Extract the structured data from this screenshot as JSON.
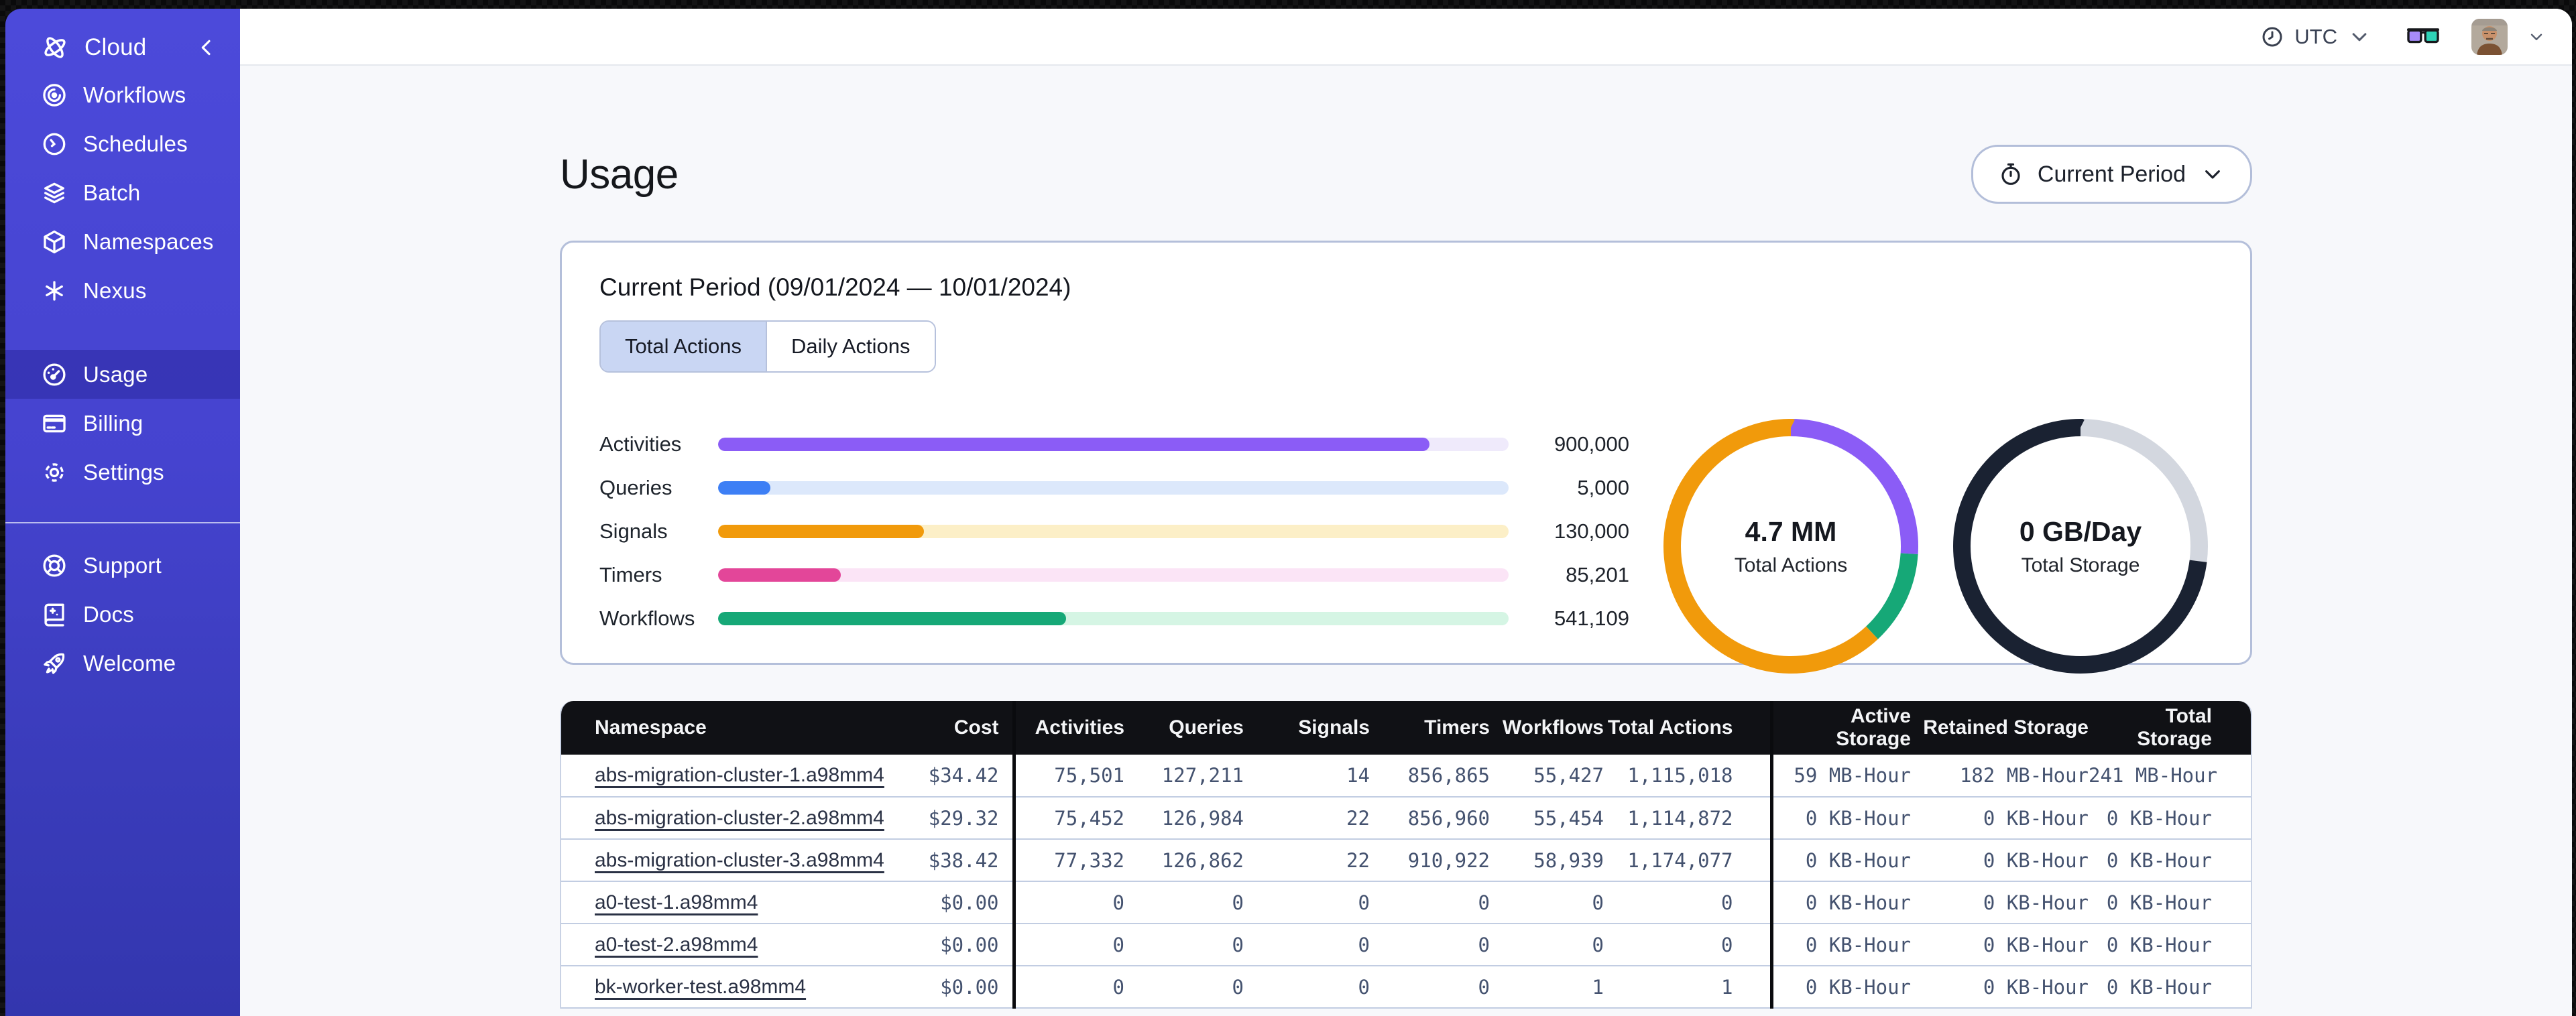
{
  "colors": {
    "sidebar_top": "#4c4ada",
    "sidebar_bottom": "#3336ae",
    "accent_purple": "#8b5cf6",
    "accent_blue": "#3d7ff5",
    "accent_orange": "#f19a0b",
    "accent_pink": "#e34699",
    "accent_green": "#16a877",
    "storage_dark": "#1a2232",
    "storage_gray": "#d3d7df",
    "table_header_bg": "#101115"
  },
  "sidebar": {
    "brand": {
      "label": "Cloud",
      "icon": "temporal-logo",
      "collapse_icon": "chevron-left"
    },
    "sections": [
      {
        "items": [
          {
            "id": "workflows",
            "label": "Workflows",
            "icon": "workflows",
            "active": false
          },
          {
            "id": "schedules",
            "label": "Schedules",
            "icon": "schedules",
            "active": false
          },
          {
            "id": "batch",
            "label": "Batch",
            "icon": "batch",
            "active": false
          },
          {
            "id": "namespaces",
            "label": "Namespaces",
            "icon": "namespaces",
            "active": false
          },
          {
            "id": "nexus",
            "label": "Nexus",
            "icon": "nexus",
            "active": false
          }
        ]
      },
      {
        "items": [
          {
            "id": "usage",
            "label": "Usage",
            "icon": "usage",
            "active": true
          },
          {
            "id": "billing",
            "label": "Billing",
            "icon": "billing",
            "active": false
          },
          {
            "id": "settings",
            "label": "Settings",
            "icon": "settings",
            "active": false
          }
        ]
      },
      {
        "items": [
          {
            "id": "support",
            "label": "Support",
            "icon": "support",
            "active": false
          },
          {
            "id": "docs",
            "label": "Docs",
            "icon": "docs",
            "active": false
          },
          {
            "id": "welcome",
            "label": "Welcome",
            "icon": "welcome",
            "active": false
          }
        ]
      }
    ]
  },
  "topbar": {
    "timezone": "UTC"
  },
  "page": {
    "title": "Usage",
    "period_button_label": "Current Period"
  },
  "usage_card": {
    "title": "Current Period (09/01/2024 — 10/01/2024)",
    "tabs": [
      {
        "label": "Total Actions",
        "active": true
      },
      {
        "label": "Daily Actions",
        "active": false
      }
    ]
  },
  "chart_data": [
    {
      "type": "bar",
      "orientation": "horizontal",
      "categories": [
        "Activities",
        "Queries",
        "Signals",
        "Timers",
        "Workflows"
      ],
      "values": [
        900000,
        5000,
        130000,
        85201,
        541109
      ],
      "value_labels": [
        "900,000",
        "5,000",
        "130,000",
        "85,201",
        "541,109"
      ],
      "fill_fractions": [
        0.9,
        0.066,
        0.26,
        0.155,
        0.44
      ],
      "bar_colors": [
        "#8b5cf6",
        "#3d7ff5",
        "#f19a0b",
        "#e34699",
        "#16a877"
      ],
      "track_colors": [
        "#efeafb",
        "#dce8fb",
        "#fcefc7",
        "#fbe4f6",
        "#d5f5e4"
      ]
    },
    {
      "type": "donut",
      "center_value": "4.7 MM",
      "center_label": "Total Actions",
      "segments": [
        {
          "name": "activities",
          "color": "#8b5cf6",
          "fraction": 0.26
        },
        {
          "name": "workflows",
          "color": "#16a877",
          "fraction": 0.12
        },
        {
          "name": "other",
          "color": "#f19a0b",
          "fraction": 0.62
        }
      ]
    },
    {
      "type": "donut",
      "center_value": "0 GB/Day",
      "center_label": "Total Storage",
      "segments": [
        {
          "name": "free",
          "color": "#d3d7df",
          "fraction": 0.27
        },
        {
          "name": "used",
          "color": "#1a2232",
          "fraction": 0.73
        }
      ]
    }
  ],
  "table": {
    "columns": [
      {
        "label": "Namespace",
        "align": "left"
      },
      {
        "label": "Cost",
        "align": "right"
      },
      {
        "label": "Activities",
        "align": "right",
        "divider": true
      },
      {
        "label": "Queries",
        "align": "right"
      },
      {
        "label": "Signals",
        "align": "right"
      },
      {
        "label": "Timers",
        "align": "right"
      },
      {
        "label": "Workflows",
        "align": "right"
      },
      {
        "label": "Total Actions",
        "align": "right"
      },
      {
        "label": "Active Storage",
        "align": "right",
        "divider": true
      },
      {
        "label": "Retained Storage",
        "align": "right"
      },
      {
        "label": "Total Storage",
        "align": "right"
      }
    ],
    "rows": [
      [
        "abs-migration-cluster-1.a98mm4",
        "$34.42",
        "75,501",
        "127,211",
        "14",
        "856,865",
        "55,427",
        "1,115,018",
        "59 MB-Hour",
        "182 MB-Hour",
        "241 MB-Hour"
      ],
      [
        "abs-migration-cluster-2.a98mm4",
        "$29.32",
        "75,452",
        "126,984",
        "22",
        "856,960",
        "55,454",
        "1,114,872",
        "0 KB-Hour",
        "0 KB-Hour",
        "0 KB-Hour"
      ],
      [
        "abs-migration-cluster-3.a98mm4",
        "$38.42",
        "77,332",
        "126,862",
        "22",
        "910,922",
        "58,939",
        "1,174,077",
        "0 KB-Hour",
        "0 KB-Hour",
        "0 KB-Hour"
      ],
      [
        "a0-test-1.a98mm4",
        "$0.00",
        "0",
        "0",
        "0",
        "0",
        "0",
        "0",
        "0 KB-Hour",
        "0 KB-Hour",
        "0 KB-Hour"
      ],
      [
        "a0-test-2.a98mm4",
        "$0.00",
        "0",
        "0",
        "0",
        "0",
        "0",
        "0",
        "0 KB-Hour",
        "0 KB-Hour",
        "0 KB-Hour"
      ],
      [
        "bk-worker-test.a98mm4",
        "$0.00",
        "0",
        "0",
        "0",
        "0",
        "1",
        "1",
        "0 KB-Hour",
        "0 KB-Hour",
        "0 KB-Hour"
      ]
    ]
  }
}
